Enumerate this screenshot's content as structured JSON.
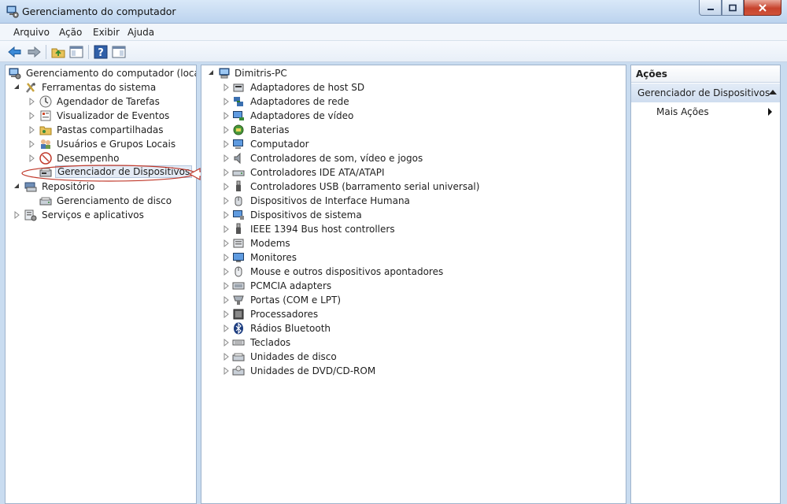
{
  "window": {
    "title": "Gerenciamento do computador"
  },
  "menu": [
    "Arquivo",
    "Ação",
    "Exibir",
    "Ajuda"
  ],
  "left_tree": {
    "root": "Gerenciamento do computador (local)",
    "system_tools": "Ferramentas do sistema",
    "tools": [
      "Agendador de Tarefas",
      "Visualizador de Eventos",
      "Pastas compartilhadas",
      "Usuários e Grupos Locais",
      "Desempenho",
      "Gerenciador de Dispositivos"
    ],
    "storage": "Repositório",
    "disk_mgmt": "Gerenciamento de disco",
    "services": "Serviços e aplicativos"
  },
  "device_tree": {
    "computer": "Dimitris-PC",
    "categories": [
      "Adaptadores de host SD",
      "Adaptadores de rede",
      "Adaptadores de vídeo",
      "Baterias",
      "Computador",
      "Controladores de som, vídeo e jogos",
      "Controladores IDE ATA/ATAPI",
      "Controladores USB (barramento serial universal)",
      "Dispositivos de Interface Humana",
      "Dispositivos de sistema",
      "IEEE 1394 Bus host controllers",
      "Modems",
      "Monitores",
      "Mouse e outros dispositivos apontadores",
      "PCMCIA adapters",
      "Portas (COM e LPT)",
      "Processadores",
      "Rádios Bluetooth",
      "Teclados",
      "Unidades de disco",
      "Unidades de DVD/CD-ROM"
    ]
  },
  "actions": {
    "header": "Ações",
    "section": "Gerenciador de Dispositivos",
    "more": "Mais Ações"
  },
  "colors": {
    "annotation": "#c0392b",
    "selected_bg": "#e4ebf5"
  }
}
